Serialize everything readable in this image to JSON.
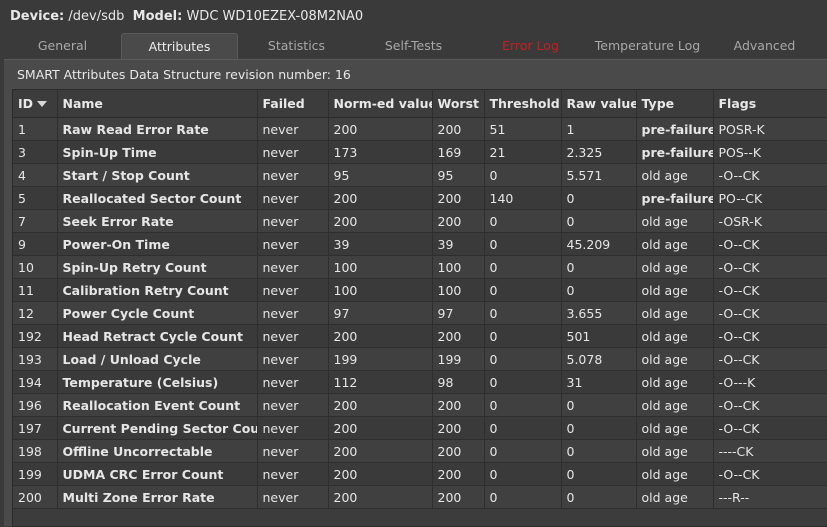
{
  "device": {
    "device_label": "Device:",
    "device_value": "/dev/sdb",
    "model_label": "Model:",
    "model_value": "WDC WD10EZEX-08M2NA0"
  },
  "tabs": [
    {
      "label": "General",
      "active": false
    },
    {
      "label": "Attributes",
      "active": true
    },
    {
      "label": "Statistics",
      "active": false
    },
    {
      "label": "Self-Tests",
      "active": false
    },
    {
      "label": "Error Log",
      "active": false,
      "error": true
    },
    {
      "label": "Temperature Log",
      "active": false
    },
    {
      "label": "Advanced",
      "active": false
    }
  ],
  "attributes": {
    "revision_text": "SMART Attributes Data Structure revision number: 16",
    "columns": [
      "ID",
      "Name",
      "Failed",
      "Norm-ed value",
      "Worst",
      "Threshold",
      "Raw value",
      "Type",
      "Flags"
    ],
    "rows": [
      {
        "id": "1",
        "name": "Raw Read Error Rate",
        "failed": "never",
        "norm": "200",
        "worst": "200",
        "threshold": "51",
        "raw": "1",
        "type": "pre-failure",
        "flags": "POSR-K"
      },
      {
        "id": "3",
        "name": "Spin-Up Time",
        "failed": "never",
        "norm": "173",
        "worst": "169",
        "threshold": "21",
        "raw": "2.325",
        "type": "pre-failure",
        "flags": "POS--K"
      },
      {
        "id": "4",
        "name": "Start / Stop Count",
        "failed": "never",
        "norm": "95",
        "worst": "95",
        "threshold": "0",
        "raw": "5.571",
        "type": "old age",
        "flags": "-O--CK"
      },
      {
        "id": "5",
        "name": "Reallocated Sector Count",
        "failed": "never",
        "norm": "200",
        "worst": "200",
        "threshold": "140",
        "raw": "0",
        "type": "pre-failure",
        "flags": "PO--CK"
      },
      {
        "id": "7",
        "name": "Seek Error Rate",
        "failed": "never",
        "norm": "200",
        "worst": "200",
        "threshold": "0",
        "raw": "0",
        "type": "old age",
        "flags": "-OSR-K"
      },
      {
        "id": "9",
        "name": "Power-On Time",
        "failed": "never",
        "norm": "39",
        "worst": "39",
        "threshold": "0",
        "raw": "45.209",
        "type": "old age",
        "flags": "-O--CK"
      },
      {
        "id": "10",
        "name": "Spin-Up Retry Count",
        "failed": "never",
        "norm": "100",
        "worst": "100",
        "threshold": "0",
        "raw": "0",
        "type": "old age",
        "flags": "-O--CK"
      },
      {
        "id": "11",
        "name": "Calibration Retry Count",
        "failed": "never",
        "norm": "100",
        "worst": "100",
        "threshold": "0",
        "raw": "0",
        "type": "old age",
        "flags": "-O--CK"
      },
      {
        "id": "12",
        "name": "Power Cycle Count",
        "failed": "never",
        "norm": "97",
        "worst": "97",
        "threshold": "0",
        "raw": "3.655",
        "type": "old age",
        "flags": "-O--CK"
      },
      {
        "id": "192",
        "name": "Head Retract Cycle Count",
        "failed": "never",
        "norm": "200",
        "worst": "200",
        "threshold": "0",
        "raw": "501",
        "type": "old age",
        "flags": "-O--CK"
      },
      {
        "id": "193",
        "name": "Load / Unload Cycle",
        "failed": "never",
        "norm": "199",
        "worst": "199",
        "threshold": "0",
        "raw": "5.078",
        "type": "old age",
        "flags": "-O--CK"
      },
      {
        "id": "194",
        "name": "Temperature (Celsius)",
        "failed": "never",
        "norm": "112",
        "worst": "98",
        "threshold": "0",
        "raw": "31",
        "type": "old age",
        "flags": "-O---K"
      },
      {
        "id": "196",
        "name": "Reallocation Event Count",
        "failed": "never",
        "norm": "200",
        "worst": "200",
        "threshold": "0",
        "raw": "0",
        "type": "old age",
        "flags": "-O--CK"
      },
      {
        "id": "197",
        "name": "Current Pending Sector Count",
        "failed": "never",
        "norm": "200",
        "worst": "200",
        "threshold": "0",
        "raw": "0",
        "type": "old age",
        "flags": "-O--CK"
      },
      {
        "id": "198",
        "name": "Offline Uncorrectable",
        "failed": "never",
        "norm": "200",
        "worst": "200",
        "threshold": "0",
        "raw": "0",
        "type": "old age",
        "flags": "----CK"
      },
      {
        "id": "199",
        "name": "UDMA CRC Error Count",
        "failed": "never",
        "norm": "200",
        "worst": "200",
        "threshold": "0",
        "raw": "0",
        "type": "old age",
        "flags": "-O--CK"
      },
      {
        "id": "200",
        "name": "Multi Zone Error Rate",
        "failed": "never",
        "norm": "200",
        "worst": "200",
        "threshold": "0",
        "raw": "0",
        "type": "old age",
        "flags": "---R--"
      }
    ]
  },
  "colors": {
    "error_tab": "#c62020",
    "background": "#3a3a3a",
    "panel": "#4a4a4a"
  }
}
